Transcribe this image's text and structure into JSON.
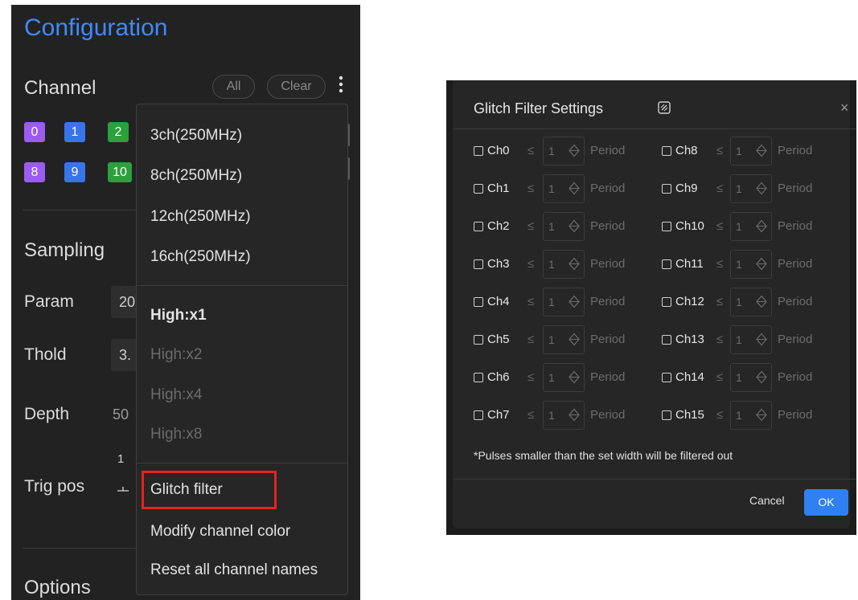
{
  "config": {
    "title": "Configuration",
    "channel_heading": "Channel",
    "all_label": "All",
    "clear_label": "Clear",
    "more_icon": "kebab-vertical-icon",
    "chips": [
      {
        "label": "0",
        "color": "#9b5cf0"
      },
      {
        "label": "1",
        "color": "#3a74ea"
      },
      {
        "label": "2",
        "color": "#2aa03e"
      },
      {
        "label": "8",
        "color": "#9b5cf0"
      },
      {
        "label": "9",
        "color": "#3a74ea"
      },
      {
        "label": "10",
        "color": "#2aa03e"
      }
    ],
    "sampling_heading": "Sampling",
    "param_label": "Param",
    "param_value": "20",
    "thold_label": "Thold",
    "thold_value": "3.",
    "depth_label": "Depth",
    "depth_value": "50",
    "trig_label": "Trig pos",
    "trig_value": "1",
    "options_heading": "Options"
  },
  "menu": {
    "channel_modes": [
      "3ch(250MHz)",
      "8ch(250MHz)",
      "12ch(250MHz)",
      "16ch(250MHz)"
    ],
    "high_items": [
      {
        "label": "High:x1",
        "enabled": true
      },
      {
        "label": "High:x2",
        "enabled": false
      },
      {
        "label": "High:x4",
        "enabled": false
      },
      {
        "label": "High:x8",
        "enabled": false
      }
    ],
    "actions": [
      "Glitch filter",
      "Modify channel color",
      "Reset all channel names"
    ],
    "highlight_color": "#e2241f"
  },
  "dialog": {
    "title": "Glitch Filter Settings",
    "edit_icon": "edit-square-icon",
    "close_icon": "close-icon",
    "close_glyph": "×",
    "le_symbol": "≤",
    "default_value": "1",
    "unit": "Period",
    "left_channels": [
      "Ch0",
      "Ch1",
      "Ch2",
      "Ch3",
      "Ch4",
      "Ch5",
      "Ch6",
      "Ch7"
    ],
    "right_channels": [
      "Ch8",
      "Ch9",
      "Ch10",
      "Ch11",
      "Ch12",
      "Ch13",
      "Ch14",
      "Ch15"
    ],
    "note": "*Pulses smaller than the set width will be filtered out",
    "cancel_label": "Cancel",
    "ok_label": "OK",
    "accent_color": "#2f80f2"
  }
}
